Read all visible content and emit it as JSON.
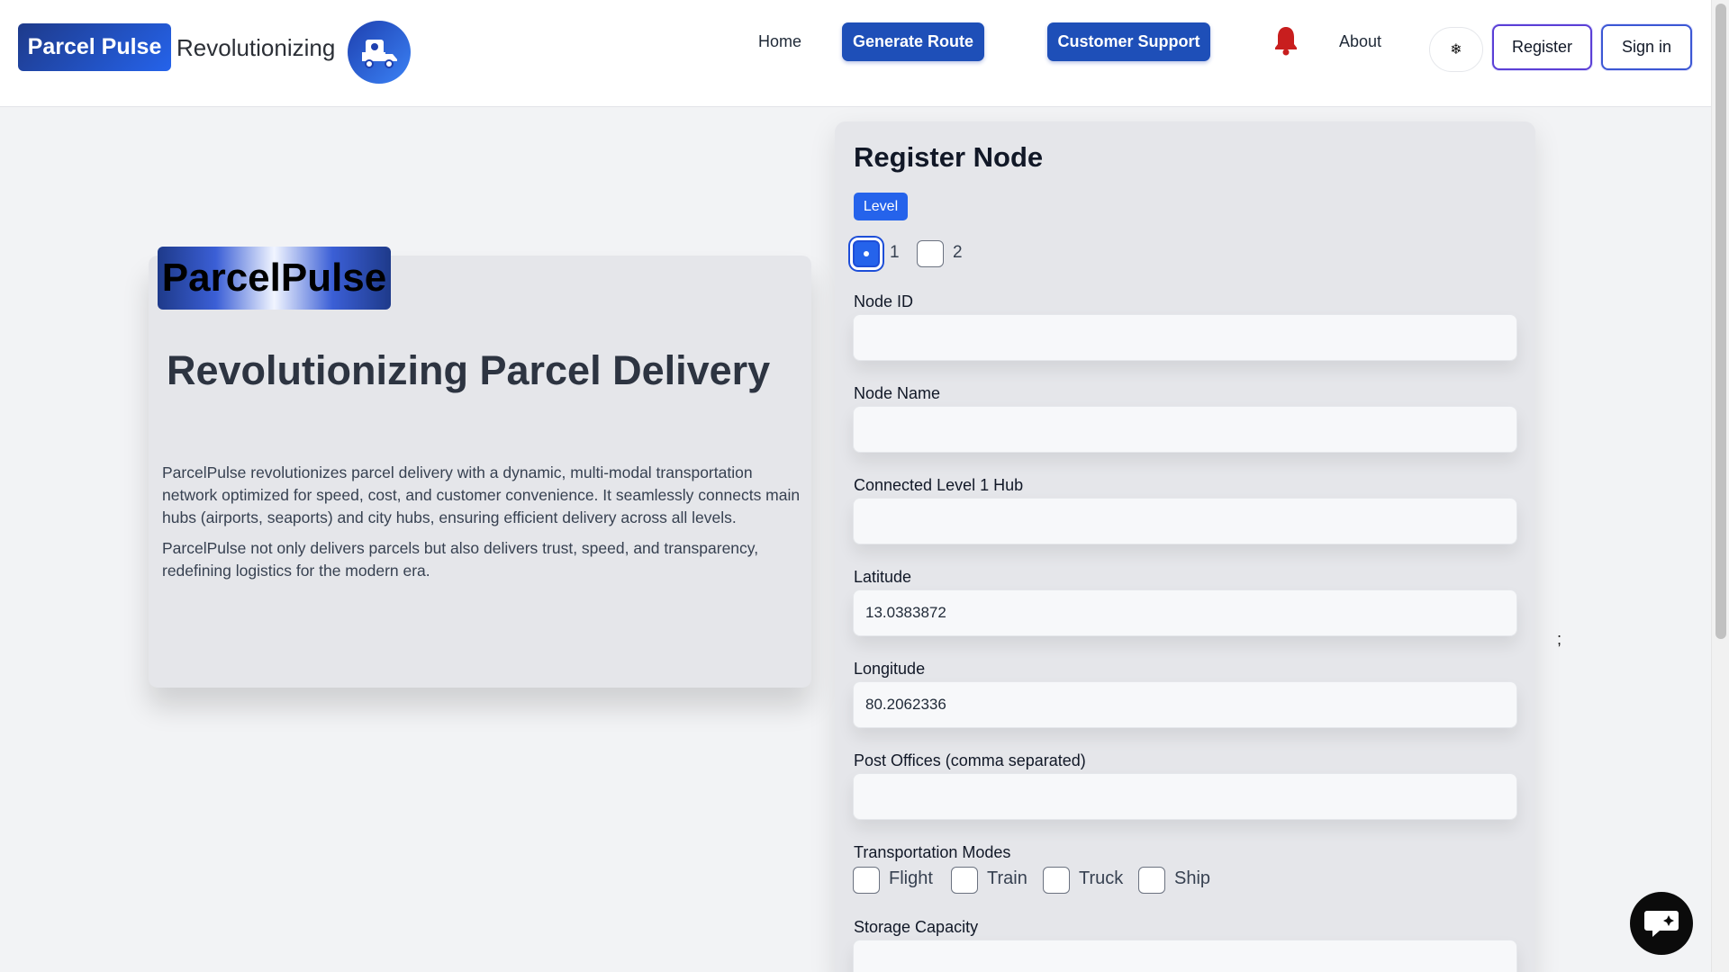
{
  "navbar": {
    "brand_name": "Parcel Pulse",
    "brand_tagline": "Revolutionizing",
    "logo_icon": "delivery-truck-icon",
    "links": {
      "home": "Home",
      "generate_route": "Generate Route",
      "customer_support": "Customer Support",
      "about": "About"
    },
    "notification_icon": "bell-icon",
    "theme_toggle_glyph": "❄",
    "register_label": "Register",
    "signin_label": "Sign in",
    "accent_color": "#1e4fb8",
    "bell_color": "#c81e1e"
  },
  "hero": {
    "badge": "ParcelPulse",
    "title": "Revolutionizing Parcel Delivery",
    "paragraph_1": "ParcelPulse revolutionizes parcel delivery with a dynamic, multi-modal transportation network optimized for speed, cost, and customer convenience. It seamlessly connects main hubs (airports, seaports) and city hubs, ensuring efficient delivery across all levels.",
    "paragraph_2": "ParcelPulse not only delivers parcels but also delivers trust, speed, and transparency, redefining logistics for the modern era."
  },
  "form": {
    "title": "Register Node",
    "level_badge": "Level",
    "level_options": [
      "1",
      "2"
    ],
    "level_selected": "1",
    "fields": {
      "node_id": {
        "label": "Node ID",
        "value": ""
      },
      "node_name": {
        "label": "Node Name",
        "value": ""
      },
      "connected_hub": {
        "label": "Connected Level 1 Hub",
        "value": ""
      },
      "latitude": {
        "label": "Latitude",
        "value": "13.0383872"
      },
      "longitude": {
        "label": "Longitude",
        "value": "80.2062336"
      },
      "post_offices": {
        "label": "Post Offices (comma separated)",
        "value": ""
      },
      "storage_capacity": {
        "label": "Storage Capacity",
        "value": ""
      }
    },
    "transport_label": "Transportation Modes",
    "transport_modes": [
      "Flight",
      "Train",
      "Truck",
      "Ship"
    ]
  },
  "stray_text": ";",
  "chat_icon": "chat-bubble-icon"
}
